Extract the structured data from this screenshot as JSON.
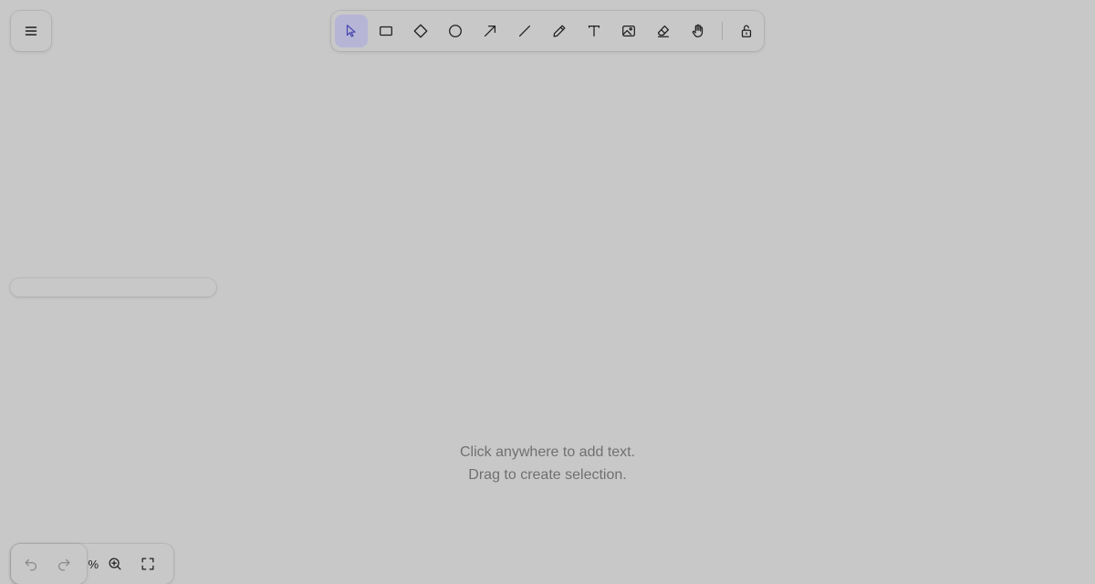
{
  "menu": {
    "icon": "hamburger-menu-icon"
  },
  "toolbar": {
    "active_tool": "selection",
    "accent_color": "#4a47b1",
    "active_background": "#b7b5d6",
    "tools": [
      {
        "name": "selection",
        "icon": "cursor-icon"
      },
      {
        "name": "rectangle",
        "icon": "rectangle-icon"
      },
      {
        "name": "diamond",
        "icon": "diamond-icon"
      },
      {
        "name": "ellipse",
        "icon": "ellipse-icon"
      },
      {
        "name": "arrow",
        "icon": "arrow-icon"
      },
      {
        "name": "line",
        "icon": "line-icon"
      },
      {
        "name": "draw",
        "icon": "pencil-icon"
      },
      {
        "name": "text",
        "icon": "text-icon"
      },
      {
        "name": "image",
        "icon": "image-icon"
      },
      {
        "name": "eraser",
        "icon": "eraser-icon"
      },
      {
        "name": "hand",
        "icon": "hand-icon"
      },
      {
        "name": "lock",
        "icon": "unlock-icon"
      }
    ]
  },
  "canvas": {
    "background": "#c8c8c8",
    "hint_line_1": "Click anywhere to add text.",
    "hint_line_2": "Drag to create selection."
  },
  "footer": {
    "undo_icon": "undo-icon",
    "redo_icon": "redo-icon",
    "zoom_text": "%",
    "zoom_in_icon": "zoom-in-icon",
    "fit_icon": "fullscreen-icon"
  }
}
